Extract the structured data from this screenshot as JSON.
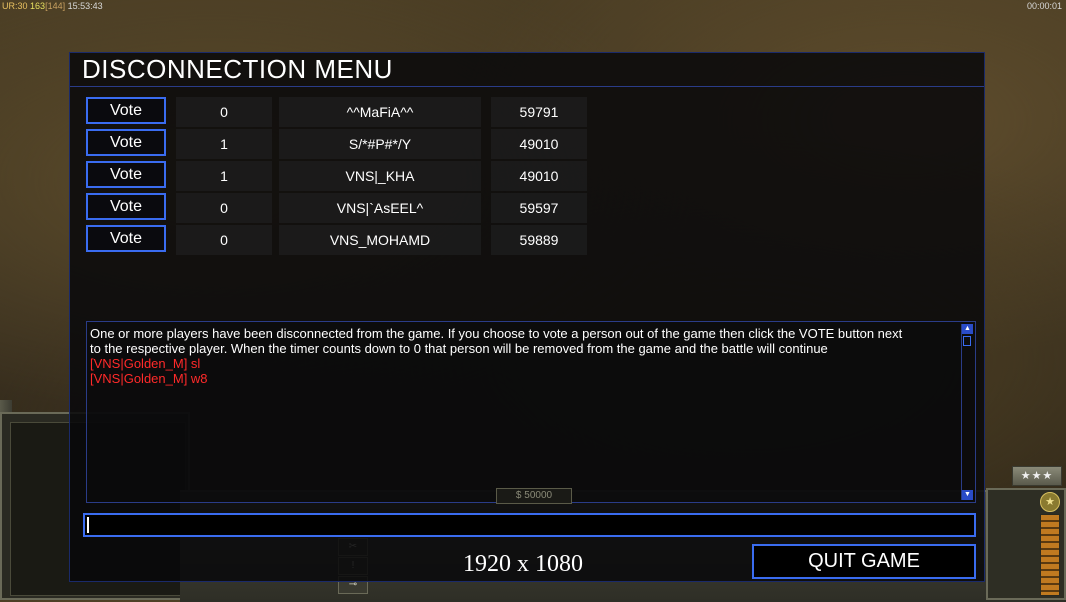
{
  "topbar": {
    "ur_label": "UR:",
    "ur_value": "30",
    "fps": "163",
    "fps_bracket": "[144]",
    "clock": "15:53:43",
    "game_timer": "00:00:01"
  },
  "dialog": {
    "title": "DISCONNECTION MENU",
    "players": [
      {
        "vote_label": "Vote",
        "votes": "0",
        "name": "^^MaFiA^^",
        "timeout": "59791"
      },
      {
        "vote_label": "Vote",
        "votes": "1",
        "name": "S/*#P#*/Y",
        "timeout": "49010"
      },
      {
        "vote_label": "Vote",
        "votes": "1",
        "name": "VNS|_KHA",
        "timeout": "49010"
      },
      {
        "vote_label": "Vote",
        "votes": "0",
        "name": "VNS|`AsEEL^",
        "timeout": "59597"
      },
      {
        "vote_label": "Vote",
        "votes": "0",
        "name": "VNS_MOHAMD",
        "timeout": "59889"
      }
    ],
    "info_line1": "One or more players have been disconnected from the game. If you choose to vote a person out of the game then click the VOTE button next",
    "info_line2": " to the respective player. When the timer counts down to 0 that person will be removed from the game and the battle will continue",
    "chat_messages": [
      "[VNS|Golden_M] sl",
      "[VNS|Golden_M] w8"
    ],
    "chat_input_value": "",
    "quit_label": "QUIT GAME"
  },
  "hud": {
    "money": "$ 50000",
    "rank_stars": "★★★",
    "rank_badge": "★"
  },
  "overlay": {
    "resolution": "1920 x 1080"
  },
  "colors": {
    "accent_blue": "#3a6cf0",
    "chat_red": "#ff2a2a"
  }
}
